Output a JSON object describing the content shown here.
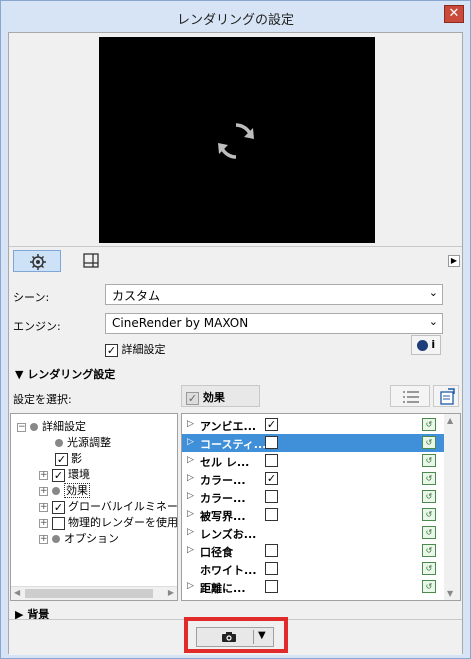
{
  "window": {
    "title": "レンダリングの設定",
    "close_label": "✕"
  },
  "scene": {
    "label": "シーン:",
    "value": "カスタム"
  },
  "engine": {
    "label": "エンジン:",
    "value": "CineRender by MAXON"
  },
  "detail_settings": {
    "label": "詳細設定",
    "checked": true
  },
  "info_button": {
    "label": "i"
  },
  "rendering_section": {
    "title": "レンダリング設定",
    "expanded": true
  },
  "select_settings_label": "設定を選択:",
  "effects_header": {
    "label": "効果",
    "checked": true
  },
  "tree": [
    {
      "label": "詳細設定",
      "expander": "−",
      "kind": "dot",
      "level": 0
    },
    {
      "label": "光源調整",
      "kind": "dot",
      "level": 1
    },
    {
      "label": "影",
      "kind": "checkbox",
      "checked": true,
      "level": 1
    },
    {
      "label": "環境",
      "expander": "+",
      "kind": "checkbox",
      "checked": true,
      "level": 1
    },
    {
      "label": "効果",
      "expander": "+",
      "kind": "dot",
      "level": 1,
      "selected": true
    },
    {
      "label": "グローバルイルミネーシ",
      "expander": "+",
      "kind": "checkbox",
      "checked": true,
      "level": 1
    },
    {
      "label": "物理的レンダーを使用",
      "expander": "+",
      "kind": "checkbox",
      "checked": false,
      "level": 1
    },
    {
      "label": "オプション",
      "expander": "+",
      "kind": "dot",
      "level": 1
    }
  ],
  "effects": [
    {
      "name": "アンビエ...",
      "checked": true,
      "has_checkbox": true
    },
    {
      "name": "コースティ...",
      "checked": true,
      "has_checkbox": true,
      "selected": true
    },
    {
      "name": "セル レ...",
      "checked": false,
      "has_checkbox": true
    },
    {
      "name": "カラー...",
      "checked": true,
      "has_checkbox": true
    },
    {
      "name": "カラー...",
      "checked": false,
      "has_checkbox": true
    },
    {
      "name": "被写界...",
      "checked": false,
      "has_checkbox": true
    },
    {
      "name": "レンズお...",
      "checked": false,
      "has_checkbox": false
    },
    {
      "name": "口径食",
      "checked": false,
      "has_checkbox": true
    },
    {
      "name": "ホワイト...",
      "checked": false,
      "has_checkbox": true
    },
    {
      "name": "距離に...",
      "checked": false,
      "has_checkbox": true
    }
  ],
  "background_section": {
    "title": "背景",
    "expanded": false
  },
  "colors": {
    "highlight": "#e12b2b",
    "selection": "#3f8fd9"
  },
  "icons": [
    "settings-gear-icon",
    "size-icon",
    "refresh-icon",
    "camera-icon",
    "list-view-icon",
    "export-icon",
    "edit-icon"
  ]
}
